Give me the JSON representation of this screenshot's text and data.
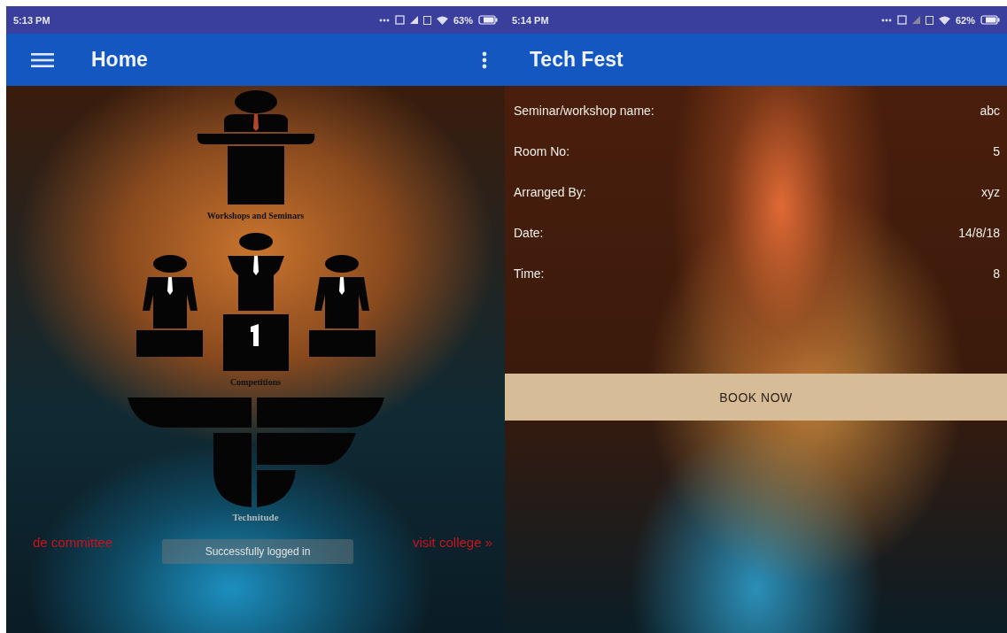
{
  "home_screen": {
    "status_bar": {
      "time": "5:13 PM",
      "battery": "63%"
    },
    "app_bar": {
      "title": "Home"
    },
    "tiles": [
      {
        "kind": "speaker",
        "label": "Workshops and Seminars"
      },
      {
        "kind": "podium",
        "label": "Competitions"
      },
      {
        "kind": "logo",
        "label": "Technitude"
      }
    ],
    "toast": "Successfully logged in",
    "marquee": [
      "de committee",
      "visit college »"
    ]
  },
  "detail_screen": {
    "status_bar": {
      "time": "5:14 PM",
      "battery": "62%"
    },
    "app_bar": {
      "title": "Tech Fest"
    },
    "fields": [
      {
        "label": "Seminar/workshop name:",
        "value": "abc"
      },
      {
        "label": "Room No:",
        "value": "5"
      },
      {
        "label": "Arranged By:",
        "value": "xyz"
      },
      {
        "label": "Date:",
        "value": "14/8/18"
      },
      {
        "label": "Time:",
        "value": "8"
      }
    ],
    "button": "BOOK NOW"
  }
}
